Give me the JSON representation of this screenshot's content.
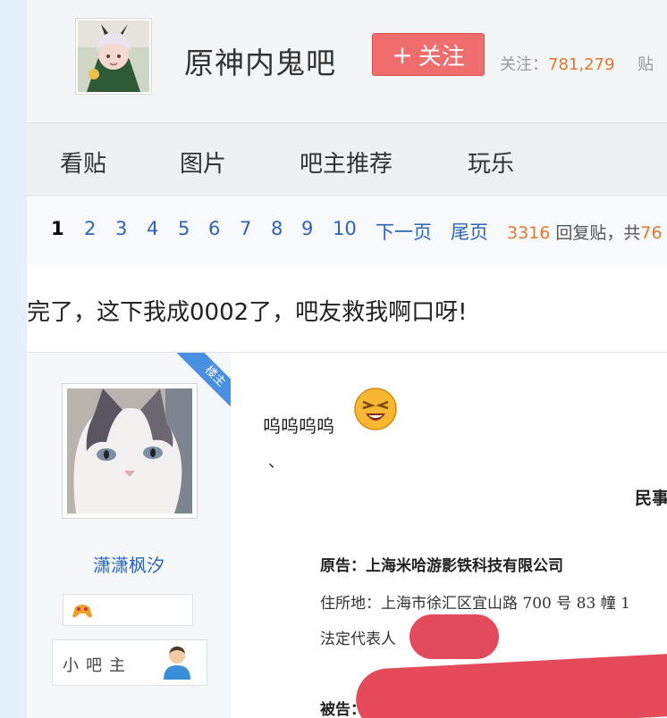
{
  "forum": {
    "name": "原神内鬼吧",
    "follow_label": "关注",
    "follow_plus": "+",
    "stats_follow_label": "关注：",
    "stats_follow_count": "781,279",
    "stats_posts_label": "贴"
  },
  "nav": {
    "items": [
      "看贴",
      "图片",
      "吧主推荐",
      "玩乐"
    ]
  },
  "pager": {
    "pages": [
      "1",
      "2",
      "3",
      "4",
      "5",
      "6",
      "7",
      "8",
      "9",
      "10"
    ],
    "current": "1",
    "next_label": "下一页",
    "last_label": "尾页",
    "reply_count": "3316",
    "reply_label": "回复贴，共",
    "total_pages_partial": "76"
  },
  "thread": {
    "title": "完了，这下我成0002了，吧友救我啊口呀!"
  },
  "author": {
    "ribbon_label": "楼主",
    "name": "潇潇枫汐",
    "role": "小吧主"
  },
  "post": {
    "text": "呜呜呜呜",
    "tick": "、",
    "doc_heading": "民事",
    "doc_plaintiff": "原告：上海米哈游影铁科技有限公司",
    "doc_address": "住所地：上海市徐汇区宜山路 700 号 83 幢 1",
    "doc_legal_rep": "法定代表人",
    "doc_defendant": "被告："
  },
  "colors": {
    "accent_link": "#2d64b3",
    "number_orange": "#e0792e",
    "follow_red": "#ef6d6d",
    "redaction_red": "#e24b5b"
  }
}
